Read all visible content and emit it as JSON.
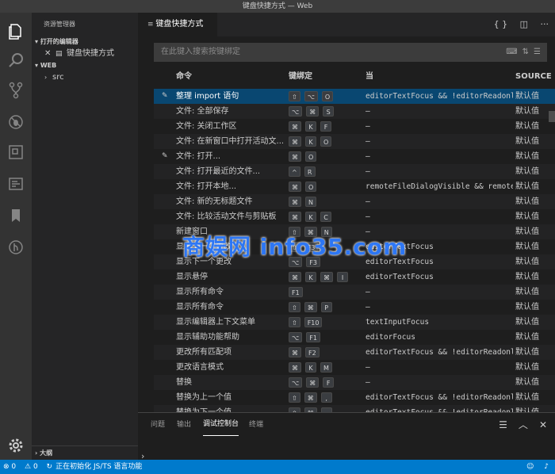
{
  "window": {
    "title": "键盘快捷方式 — Web"
  },
  "activitybar": {
    "icons": [
      "explorer-icon",
      "search-icon",
      "source-control-icon",
      "debug-icon",
      "extensions-icon",
      "terminal-icon",
      "bookmark-icon",
      "remote-icon",
      "settings-icon"
    ]
  },
  "sidebar": {
    "title": "资源管理器",
    "open_editors_label": "打开的编辑器",
    "open_editor_item": "键盘快捷方式",
    "workspace_label": "WEB",
    "folder_item": "src",
    "outline_label": "大纲"
  },
  "tab": {
    "label": "键盘快捷方式",
    "actions": [
      "{}",
      "split-editor",
      "more"
    ]
  },
  "search": {
    "placeholder": "在此键入搜索按键绑定"
  },
  "table": {
    "headers": {
      "command": "命令",
      "keybinding": "键绑定",
      "when": "当",
      "source": "SOURCE"
    },
    "rows": [
      {
        "command": "整理 import 语句",
        "keys": [
          "⇧",
          "⌥",
          "O"
        ],
        "when": "editorTextFocus && !editorReadonly",
        "source": "默认值",
        "pen": true,
        "selected": true
      },
      {
        "command": "文件: 全部保存",
        "keys": [
          "⌥",
          "⌘",
          "S"
        ],
        "when": "—",
        "source": "默认值"
      },
      {
        "command": "文件: 关闭工作区",
        "keys": [
          "⌘",
          "K",
          "F"
        ],
        "when": "—",
        "source": "默认值"
      },
      {
        "command": "文件: 在新窗口中打开活动文...",
        "keys": [
          "⌘",
          "K",
          "O"
        ],
        "when": "—",
        "source": "默认值"
      },
      {
        "command": "文件: 打开...",
        "keys": [
          "⌘",
          "O"
        ],
        "when": "—",
        "source": "默认值",
        "pen": true
      },
      {
        "command": "文件: 打开最近的文件...",
        "keys": [
          "^",
          "R"
        ],
        "when": "—",
        "source": "默认值"
      },
      {
        "command": "文件: 打开本地...",
        "keys": [
          "⌘",
          "O"
        ],
        "when": "remoteFileDialogVisible && remoteFileDialog",
        "source": "默认值"
      },
      {
        "command": "文件: 新的无标题文件",
        "keys": [
          "⌘",
          "N"
        ],
        "when": "—",
        "source": "默认值"
      },
      {
        "command": "文件: 比较活动文件与剪贴板",
        "keys": [
          "⌘",
          "K",
          "C"
        ],
        "when": "—",
        "source": "默认值"
      },
      {
        "command": "新建窗口",
        "keys": [
          "⇧",
          "⌘",
          "N"
        ],
        "when": "—",
        "source": "默认值"
      },
      {
        "command": "显示上一个更改",
        "keys": [
          "⇧",
          "F3"
        ],
        "when": "editorTextFocus",
        "source": "默认值"
      },
      {
        "command": "显示下一个更改",
        "keys": [
          "⌥",
          "F3"
        ],
        "when": "editorTextFocus",
        "source": "默认值"
      },
      {
        "command": "显示悬停",
        "keys": [
          "⌘",
          "K",
          "⌘",
          "I"
        ],
        "when": "editorTextFocus",
        "source": "默认值"
      },
      {
        "command": "显示所有命令",
        "keys": [
          "F1"
        ],
        "when": "—",
        "source": "默认值"
      },
      {
        "command": "显示所有命令",
        "keys": [
          "⇧",
          "⌘",
          "P"
        ],
        "when": "—",
        "source": "默认值"
      },
      {
        "command": "显示编辑器上下文菜单",
        "keys": [
          "⇧",
          "F10"
        ],
        "when": "textInputFocus",
        "source": "默认值"
      },
      {
        "command": "显示辅助功能帮助",
        "keys": [
          "⌥",
          "F1"
        ],
        "when": "editorFocus",
        "source": "默认值"
      },
      {
        "command": "更改所有匹配项",
        "keys": [
          "⌘",
          "F2"
        ],
        "when": "editorTextFocus && !editorReadonly",
        "source": "默认值"
      },
      {
        "command": "更改语言模式",
        "keys": [
          "⌘",
          "K",
          "M"
        ],
        "when": "—",
        "source": "默认值"
      },
      {
        "command": "替换",
        "keys": [
          "⌥",
          "⌘",
          "F"
        ],
        "when": "—",
        "source": "默认值"
      },
      {
        "command": "替换为上一个值",
        "keys": [
          "⇧",
          "⌘",
          ","
        ],
        "when": "editorTextFocus && !editorReadonly",
        "source": "默认值"
      },
      {
        "command": "替换为下一个值",
        "keys": [
          "⇧",
          "⌘",
          "."
        ],
        "when": "editorTextFocus && !editorReadonly",
        "source": "默认值"
      }
    ]
  },
  "panel": {
    "tabs": [
      "问题",
      "输出",
      "调试控制台",
      "终端"
    ],
    "active_tab": "调试控制台",
    "prompt": "›"
  },
  "statusbar": {
    "errors": "⊗ 0",
    "warnings": "⚠ 0",
    "progress": "正在初始化 JS/TS 语言功能"
  },
  "watermark": "商娱网 info35.com"
}
